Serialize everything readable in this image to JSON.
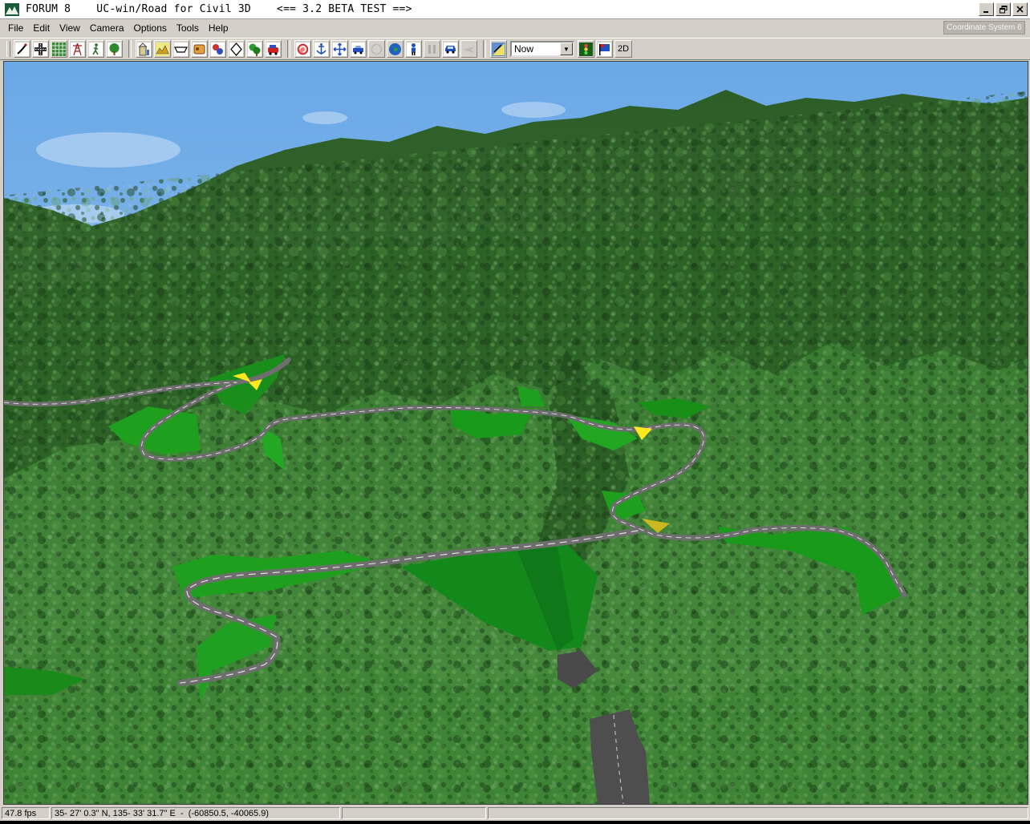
{
  "window": {
    "title": "FORUM 8    UC-win/Road for Civil 3D    <== 3.2 BETA TEST ==>",
    "controls": [
      "minimize",
      "restore",
      "close"
    ]
  },
  "menu": {
    "items": [
      {
        "label": "File"
      },
      {
        "label": "Edit"
      },
      {
        "label": "View"
      },
      {
        "label": "Camera"
      },
      {
        "label": "Options"
      },
      {
        "label": "Tools"
      },
      {
        "label": "Help"
      }
    ]
  },
  "coordinate_system": "Coordinate System 6",
  "toolbar": {
    "time_select": {
      "value": "Now"
    },
    "mode_2d_label": "2D",
    "icons": [
      "road-define-icon",
      "intersection-icon",
      "grid-icon",
      "transmission-tower-icon",
      "pedestrian-icon",
      "tree-icon",
      "building-icon",
      "terrain-edit-icon",
      "cross-section-icon",
      "model-icon",
      "traffic-icon",
      "sign-icon",
      "vegetation-icon",
      "vehicle-icon",
      "camera-rotate-icon",
      "anchor-icon",
      "move-icon",
      "drive-icon",
      "fly-icon",
      "globe-icon",
      "person-icon",
      "pause-icon",
      "car-icon",
      "flight-icon",
      "weather-icon",
      "traffic-light-icon",
      "flag-icon"
    ]
  },
  "status": {
    "fps": "47.8 fps",
    "coordinates": "35- 27' 0.3\" N, 135- 33' 31.7\" E  -  (-60850.5, -40065.9)"
  },
  "colors": {
    "sky": "#7fb3e8",
    "terrain_dark": "#1f4a1c",
    "terrain_mid": "#3c7a32",
    "slope_green": "#1f9a1f",
    "road_gray": "#8c8c8c"
  }
}
